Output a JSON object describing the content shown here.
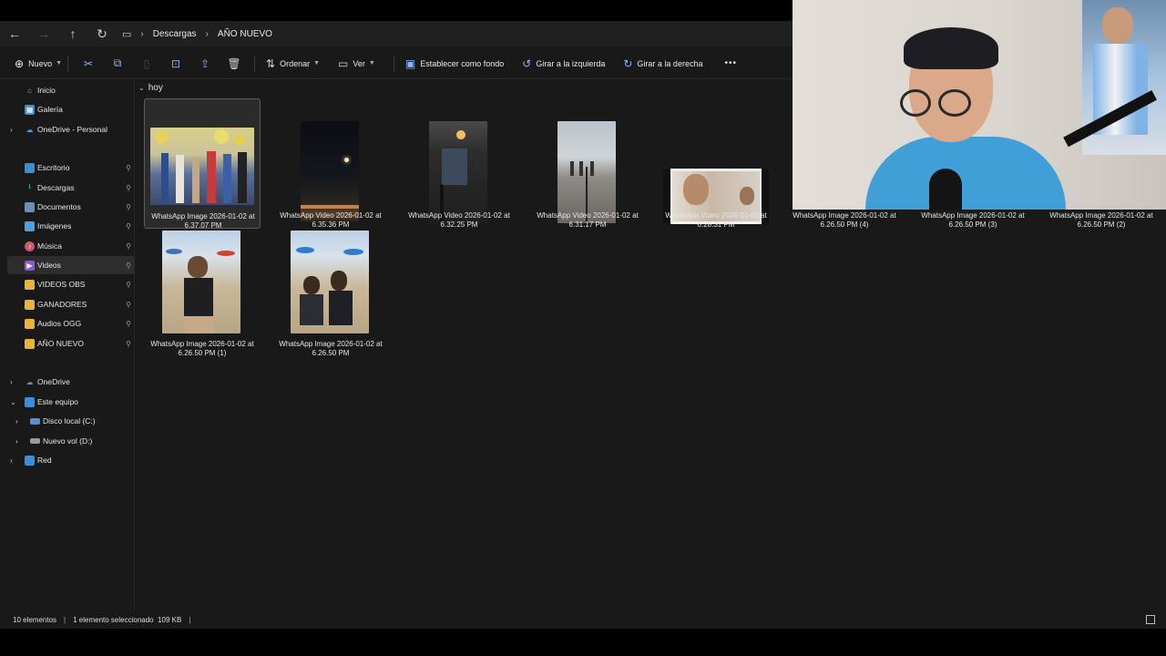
{
  "address": {
    "crumbs": [
      "Descargas",
      "AÑO NUEVO"
    ]
  },
  "toolbar": {
    "new_label": "Nuevo",
    "sort_label": "Ordenar",
    "view_label": "Ver",
    "set_background_label": "Establecer como fondo",
    "rotate_left_label": "Girar a la izquierda",
    "rotate_right_label": "Girar a la derecha",
    "more_label": "•••"
  },
  "sidebar": {
    "items": [
      {
        "label": "Inicio",
        "icon": "home-icon"
      },
      {
        "label": "Galería",
        "icon": "gallery-icon"
      },
      {
        "label": "OneDrive - Personal",
        "icon": "cloud-icon"
      },
      {
        "label": "Escritorio",
        "icon": "desktop-icon"
      },
      {
        "label": "Descargas",
        "icon": "download-icon"
      },
      {
        "label": "Documentos",
        "icon": "documents-icon"
      },
      {
        "label": "Imágenes",
        "icon": "pictures-icon"
      },
      {
        "label": "Música",
        "icon": "music-icon"
      },
      {
        "label": "Videos",
        "icon": "videos-icon"
      },
      {
        "label": "VIDEOS OBS",
        "icon": "folder-icon"
      },
      {
        "label": "GANADORES",
        "icon": "folder-icon"
      },
      {
        "label": "Audios OGG",
        "icon": "folder-icon"
      },
      {
        "label": "AÑO NUEVO",
        "icon": "folder-icon"
      },
      {
        "label": "OneDrive",
        "icon": "cloud-icon"
      },
      {
        "label": "Este equipo",
        "icon": "computer-icon"
      },
      {
        "label": "Disco local (C:)",
        "icon": "drive-icon"
      },
      {
        "label": "Nuevo vol (D:)",
        "icon": "drive-icon"
      },
      {
        "label": "Red",
        "icon": "network-icon"
      }
    ]
  },
  "content": {
    "group_label": "hoy",
    "files": [
      {
        "line1": "WhatsApp Image 2026-01-02 at",
        "line2": "6.37.07 PM"
      },
      {
        "line1": "WhatsApp Video 2026-01-02 at",
        "line2": "6.35.36 PM"
      },
      {
        "line1": "WhatsApp Video 2026-01-02 at",
        "line2": "6.32.25 PM"
      },
      {
        "line1": "WhatsApp Video 2026-01-02 at",
        "line2": "6.31.17 PM"
      },
      {
        "line1": "WhatsApp Video 2026-01-02 at",
        "line2": "6.28.31 PM"
      },
      {
        "line1": "WhatsApp Image 2026-01-02 at",
        "line2": "6.26.50 PM (4)"
      },
      {
        "line1": "WhatsApp Image 2026-01-02 at",
        "line2": "6.26.50 PM (3)"
      },
      {
        "line1": "WhatsApp Image 2026-01-02 at",
        "line2": "6.26.50 PM (2)"
      },
      {
        "line1": "WhatsApp Image 2026-01-02 at",
        "line2": "6.26.50 PM (1)"
      },
      {
        "line1": "WhatsApp Image 2026-01-02 at",
        "line2": "6.26.50 PM"
      }
    ]
  },
  "status": {
    "count": "10 elementos",
    "selection": "1 elemento seleccionado  109 KB"
  },
  "colors": {
    "window_bg": "#191919",
    "accent": "#8ab4f8",
    "folder": "#e8b53a"
  }
}
